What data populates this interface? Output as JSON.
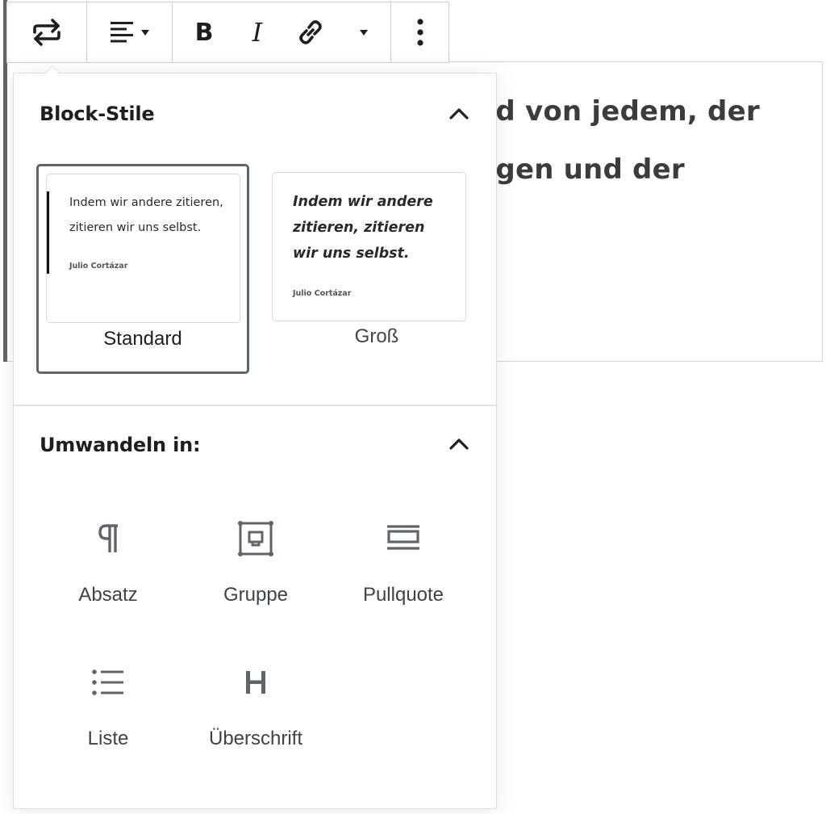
{
  "background": {
    "line1": "nd von jedem, der",
    "line2": "ngen und der"
  },
  "toolbar": {
    "transform_icon": "transform-arrows-icon",
    "align_icon": "align-left-icon",
    "bold_label": "B",
    "italic_label": "I",
    "link_icon": "link-icon",
    "more_icon": "more-vertical-icon"
  },
  "block_styles": {
    "title": "Block-Stile",
    "styles": [
      {
        "label": "Standard",
        "quote": "Indem wir andere zitieren, zitieren wir uns selbst.",
        "cite": "Julio Cortázar",
        "selected": true
      },
      {
        "label": "Groß",
        "quote": "Indem wir andere zitieren, zitieren wir uns selbst.",
        "cite": "Julio Cortázar",
        "selected": false
      }
    ]
  },
  "transform": {
    "title": "Umwandeln in:",
    "items": [
      {
        "label": "Absatz",
        "icon": "paragraph-icon"
      },
      {
        "label": "Gruppe",
        "icon": "group-icon"
      },
      {
        "label": "Pullquote",
        "icon": "pullquote-icon"
      },
      {
        "label": "Liste",
        "icon": "list-icon"
      },
      {
        "label": "Überschrift",
        "icon": "heading-icon"
      }
    ]
  },
  "colors": {
    "accent": "#60656b",
    "text": "#1e1e1e",
    "border": "#d4d4d4"
  }
}
